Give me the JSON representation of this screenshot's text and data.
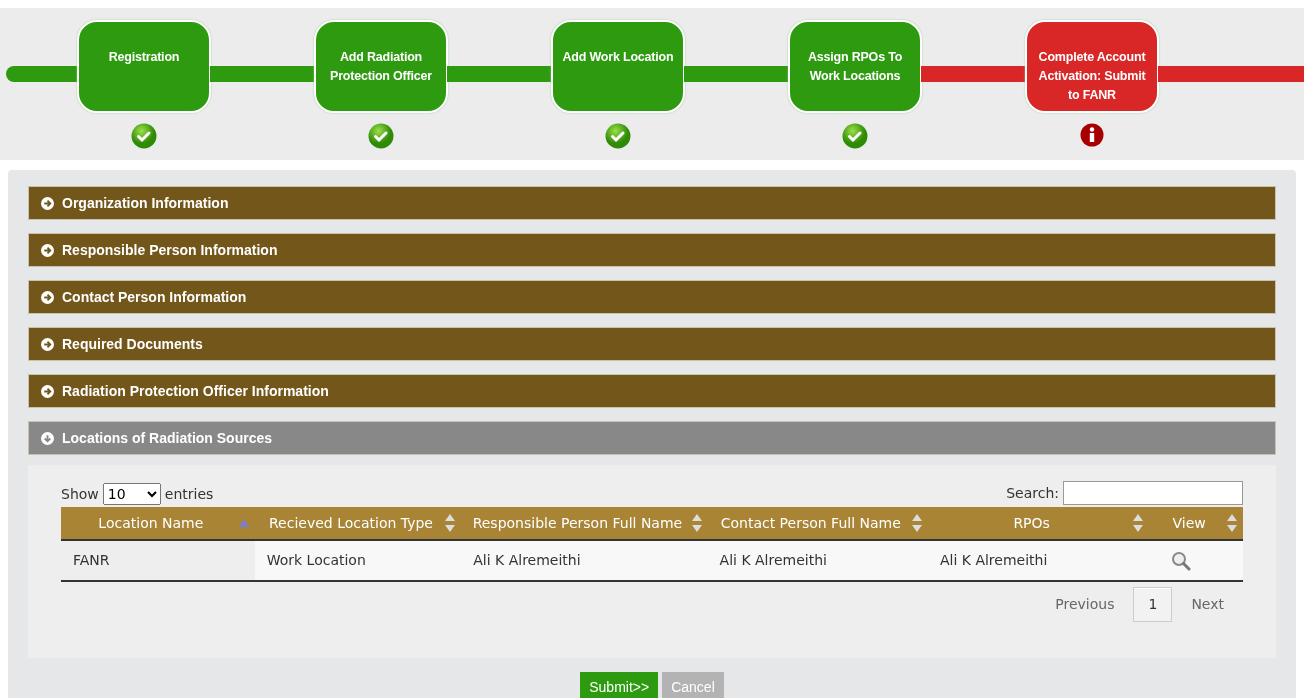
{
  "steps": [
    {
      "label": "Registration",
      "complete": true
    },
    {
      "label": "Add Radiation Protection Officer",
      "complete": true
    },
    {
      "label": "Add Work Location",
      "complete": true
    },
    {
      "label": "Assign RPOs To Work Locations",
      "complete": true
    },
    {
      "label": "Complete Account Activation: Submit to FANR",
      "complete": false
    }
  ],
  "sections": [
    {
      "title": "Organization Information",
      "expanded": false
    },
    {
      "title": "Responsible Person Information",
      "expanded": false
    },
    {
      "title": "Contact Person Information",
      "expanded": false
    },
    {
      "title": "Required Documents",
      "expanded": false
    },
    {
      "title": "Radiation Protection Officer Information",
      "expanded": false
    },
    {
      "title": "Locations of Radiation Sources",
      "expanded": true
    }
  ],
  "table": {
    "show_label": "Show",
    "page_size": "10",
    "entries_label": "entries",
    "search_label": "Search:",
    "columns": [
      {
        "label": "Location Name",
        "sorted": true
      },
      {
        "label": "Recieved Location Type",
        "sorted": false
      },
      {
        "label": "Responsible Person Full Name",
        "sorted": false
      },
      {
        "label": "Contact Person Full Name",
        "sorted": false
      },
      {
        "label": "RPOs",
        "sorted": false
      },
      {
        "label": "View",
        "sorted": false
      }
    ],
    "rows": [
      {
        "cells": [
          "FANR",
          "Work Location",
          "Ali K Alremeithi",
          "Ali K Alremeithi",
          "Ali K Alremeithi"
        ]
      }
    ],
    "pagination": {
      "previous": "Previous",
      "pages": [
        {
          "label": "1",
          "selected": true
        }
      ],
      "next": "Next"
    }
  },
  "buttons": [
    {
      "label": "Submit>>",
      "disabled": false
    },
    {
      "label": "Cancel",
      "disabled": true
    }
  ]
}
